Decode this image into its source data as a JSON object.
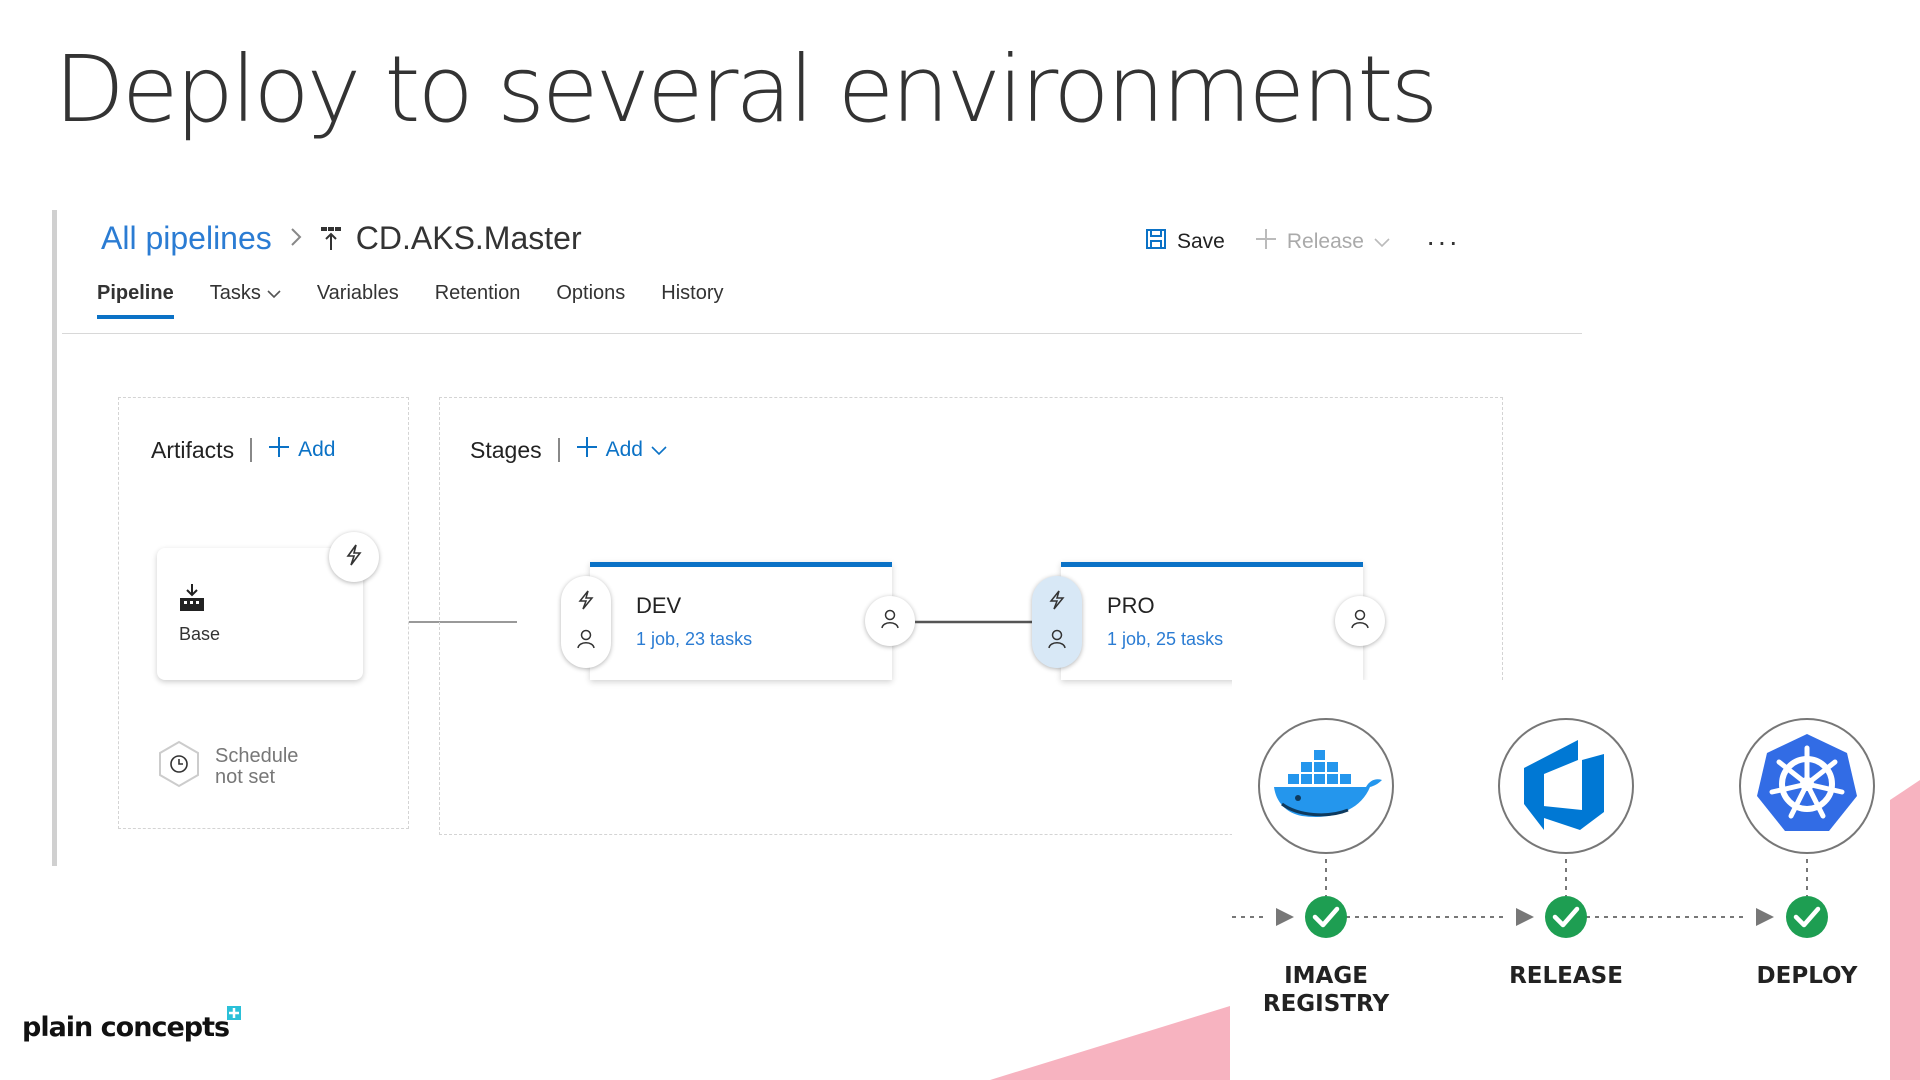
{
  "slide": {
    "title": "Deploy to several environments"
  },
  "breadcrumb": {
    "root": "All pipelines",
    "current": "CD.AKS.Master"
  },
  "toolbar": {
    "save_label": "Save",
    "release_label": "Release",
    "more_label": "···"
  },
  "tabs": [
    {
      "label": "Pipeline",
      "active": true
    },
    {
      "label": "Tasks"
    },
    {
      "label": "Variables"
    },
    {
      "label": "Retention"
    },
    {
      "label": "Options"
    },
    {
      "label": "History"
    }
  ],
  "artifacts": {
    "heading": "Artifacts",
    "add_label": "Add",
    "items": [
      {
        "name": "Base",
        "icon": "build-artifact-icon"
      }
    ],
    "schedule": {
      "line1": "Schedule",
      "line2": "not set"
    }
  },
  "stages": {
    "heading": "Stages",
    "add_label": "Add",
    "items": [
      {
        "name": "DEV",
        "summary": "1 job, 23 tasks"
      },
      {
        "name": "PRO",
        "summary": "1 job, 25 tasks"
      }
    ]
  },
  "flow": {
    "steps": [
      {
        "label_line1": "IMAGE",
        "label_line2": "REGISTRY",
        "icon": "docker-icon",
        "status": "success"
      },
      {
        "label_line1": "RELEASE",
        "label_line2": "",
        "icon": "azure-devops-icon",
        "status": "success"
      },
      {
        "label_line1": "DEPLOY",
        "label_line2": "",
        "icon": "kubernetes-icon",
        "status": "success"
      }
    ]
  },
  "brand": {
    "logo_text": "plain concepts"
  },
  "colors": {
    "accent": "#0b72c6",
    "link": "#2b7cd3",
    "success": "#1e9e52",
    "pink": "#f7b3c0",
    "kubernetes": "#326ce5",
    "azure": "#0078d4",
    "docker": "#2496ed"
  }
}
